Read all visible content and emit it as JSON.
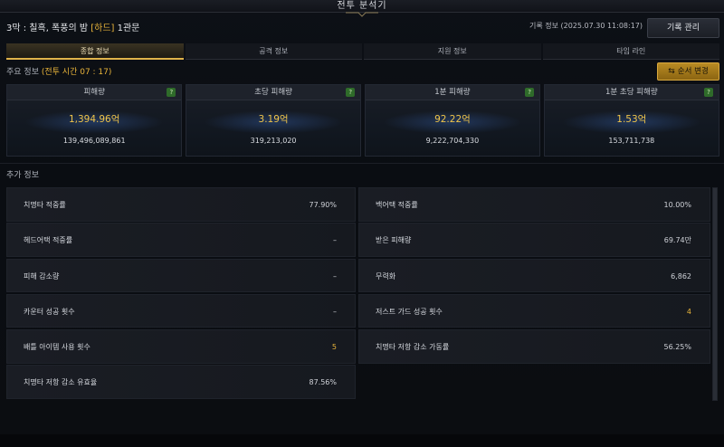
{
  "window": {
    "title": "전투 분석기"
  },
  "header": {
    "stage_prefix": "3막 : 칠흑, 폭풍의 밤 ",
    "difficulty": "[하드]",
    "gate": " 1관문",
    "record_info": "기록 정보 (2025.07.30 11:08:17)",
    "record_manage_label": "기록 관리"
  },
  "tabs": [
    {
      "label": "종합 정보",
      "active": true
    },
    {
      "label": "공격 정보",
      "active": false
    },
    {
      "label": "지원 정보",
      "active": false
    },
    {
      "label": "타임 라인",
      "active": false
    }
  ],
  "main_info": {
    "label": "주요 정보",
    "battle_time": "(전투 시간 07 : 17)",
    "order_change_label": "순서 변경"
  },
  "cards": [
    {
      "title": "피해량",
      "main": "1,394.96억",
      "sub": "139,496,089,861"
    },
    {
      "title": "초당 피해량",
      "main": "3.19억",
      "sub": "319,213,020"
    },
    {
      "title": "1분 피해량",
      "main": "92.22억",
      "sub": "9,222,704,330"
    },
    {
      "title": "1분 초당 피해량",
      "main": "1.53억",
      "sub": "153,711,738"
    }
  ],
  "extra_info": {
    "label": "추가 정보",
    "left": [
      {
        "label": "치명타 적중률",
        "value": "77.90%"
      },
      {
        "label": "헤드어택 적중률",
        "value": "–"
      },
      {
        "label": "피해 감소량",
        "value": "–"
      },
      {
        "label": "카운터 성공 횟수",
        "value": "–"
      },
      {
        "label": "배틀 아이템 사용 횟수",
        "value": "5"
      },
      {
        "label": "치명타 저항 감소 유효율",
        "value": "87.56%"
      }
    ],
    "right": [
      {
        "label": "백어택 적중률",
        "value": "10.00%"
      },
      {
        "label": "받은 피해량",
        "value": "69.74만"
      },
      {
        "label": "무력화",
        "value": "6,862"
      },
      {
        "label": "저스트 가드 성공 횟수",
        "value": "4"
      },
      {
        "label": "치명타 저항 감소 가동률",
        "value": "56.25%"
      }
    ]
  },
  "colors": {
    "accent_gold": "#e8b43a",
    "help_green": "#2f6b2a"
  }
}
